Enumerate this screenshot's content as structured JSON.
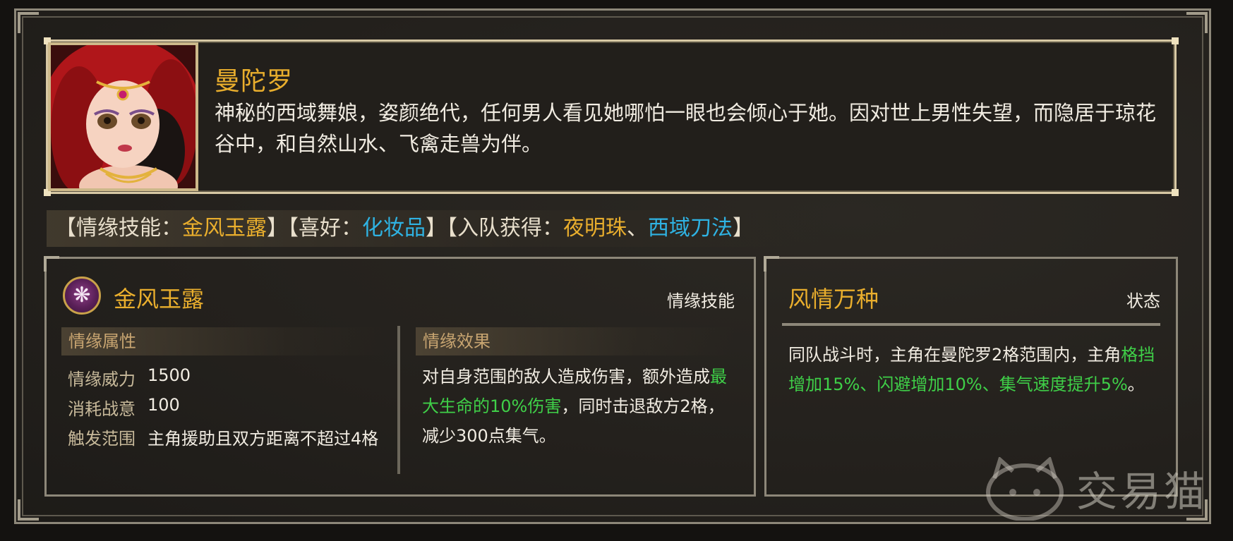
{
  "character": {
    "name": "曼陀罗",
    "description": "神秘的西域舞娘，姿颜绝代，任何男人看见她哪怕一眼也会倾心于她。因对世上男性失望，而隐居于琼花谷中，和自然山水、飞禽走兽为伴。"
  },
  "tags": {
    "skill_prefix": "【情缘技能：",
    "skill_value": "金风玉露",
    "skill_suffix": "】",
    "hobby_prefix": "【喜好：",
    "hobby_value": "化妆品",
    "hobby_suffix": "】",
    "join_prefix": "【入队获得：",
    "join_item": "夜明珠",
    "join_sep": "、",
    "join_skill": "西域刀法",
    "join_suffix": "】"
  },
  "skill_panel": {
    "name": "金风玉露",
    "type": "情缘技能",
    "icon": "lotus-skill-icon",
    "attributes_header": "情缘属性",
    "attributes": [
      {
        "label": "情缘威力",
        "value": "1500"
      },
      {
        "label": "消耗战意",
        "value": "100"
      },
      {
        "label": "触发范围",
        "value": "主角援助且双方距离不超过4格"
      }
    ],
    "effect_header": "情缘效果",
    "effect_part1": "对自身范围的敌人造成伤害，额外造成",
    "effect_highlight": "最大生命的10%伤害",
    "effect_part2": "，同时击退敌方2格，减少300点集气。"
  },
  "state_panel": {
    "name": "风情万种",
    "type": "状态",
    "desc_part1": "同队战斗时，主角在曼陀罗2格范围内，主角",
    "desc_highlight1": "格挡增加15%",
    "desc_sep1": "、",
    "desc_highlight2": "闪避增加10%",
    "desc_sep2": "、",
    "desc_highlight3": "集气速度提升5%",
    "desc_end": "。"
  },
  "watermark": "交易猫",
  "colors": {
    "gold": "#e9ae2d",
    "cyan": "#2fb3e3",
    "green": "#3fcf48"
  }
}
